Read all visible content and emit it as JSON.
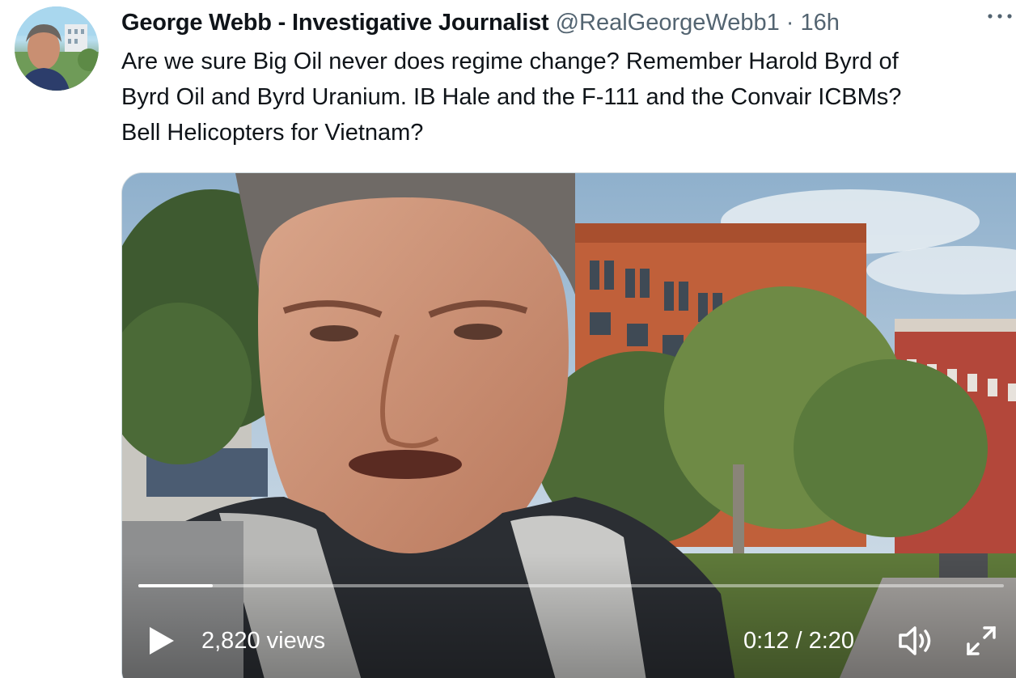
{
  "tweet": {
    "display_name": "George Webb - Investigative Journalist",
    "handle": "@RealGeorgeWebb1",
    "separator": "·",
    "time": "16h",
    "more_icon": "more-horizontal-icon",
    "text": "Are we sure Big Oil never does regime change?  Remember Harold Byrd of\nByrd Oil and Byrd Uranium. IB Hale and the F-111 and the Convair ICBMs?\nBell Helicopters for Vietnam?"
  },
  "video": {
    "views": "2,820 views",
    "time_readout": "0:12 / 2:20",
    "progress_fraction": 0.0857,
    "play_icon": "play-icon",
    "volume_icon": "volume-icon",
    "fullscreen_icon": "fullscreen-icon"
  },
  "colors": {
    "text_primary": "#0f1419",
    "text_secondary": "#536471",
    "border": "#cfd9de"
  }
}
